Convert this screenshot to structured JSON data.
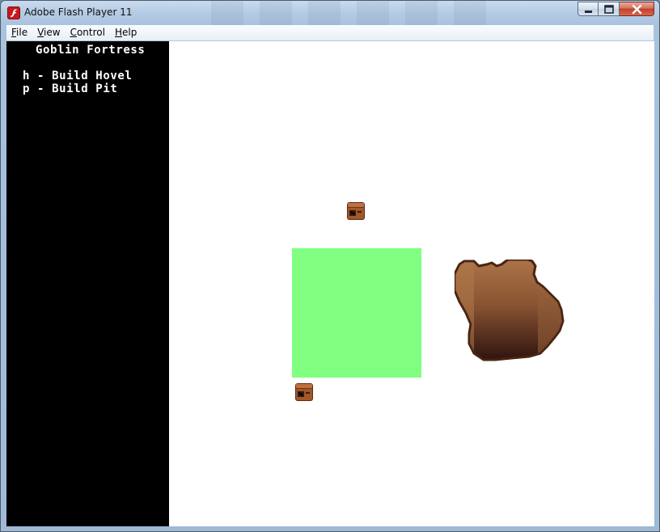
{
  "window": {
    "title": "Adobe Flash Player 11",
    "icon": "flash-player-icon",
    "controls": [
      "minimize-icon",
      "maximize-icon",
      "close-icon"
    ]
  },
  "menu": {
    "items": [
      {
        "label": "File",
        "accel": "F",
        "rest": "ile"
      },
      {
        "label": "View",
        "accel": "V",
        "rest": "iew"
      },
      {
        "label": "Control",
        "accel": "C",
        "rest": "ontrol"
      },
      {
        "label": "Help",
        "accel": "H",
        "rest": "elp"
      }
    ]
  },
  "game": {
    "title": "Goblin Fortress",
    "hotkeys": [
      {
        "text": "h - Build Hovel"
      },
      {
        "text": "p - Build Pit"
      }
    ],
    "colors": {
      "panel": "#000000",
      "field": "#ffffff",
      "zone": "#80ff80",
      "goblin": "#8b4a24",
      "pit_top": "#a86e42",
      "pit_bottom": "#3a1a12"
    },
    "entities": [
      "goblin",
      "goblin",
      "build-zone",
      "dirt-pit"
    ]
  }
}
